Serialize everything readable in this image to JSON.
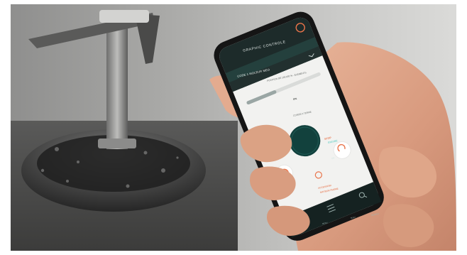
{
  "app": {
    "header_title": "GRAPHIC CONTROLE",
    "subheader": "CODE 1 MOLEUR MEO",
    "job_line": "POSITION DE 100.000 % - ELEMENTS",
    "progress_value": "0%",
    "progress_fraction": 0.4,
    "status_label": "CORDE A TERME",
    "center_button_line1": "STOP",
    "center_button_line2": "ENGINE",
    "center_button_indicator": "ON",
    "action_label_line1": "ACCESSOIR",
    "action_label_line2": "MOTEUR PHONE",
    "nav": [
      "MENU",
      "SUIVI",
      "SEARCH"
    ]
  },
  "colors": {
    "app_header": "#1d2b2a",
    "app_body": "#f2f2f0",
    "accent_orange": "#e9744a",
    "accent_teal": "#12413d",
    "nav_bar": "#152221"
  },
  "icons": [
    "logo-icon",
    "chevron-down-icon",
    "faucet-icon",
    "power-icon",
    "home-icon",
    "list-icon",
    "search-icon"
  ]
}
